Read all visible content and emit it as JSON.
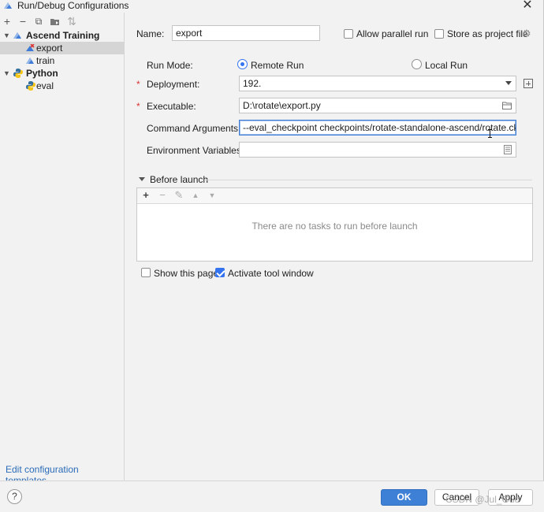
{
  "window": {
    "title": "Run/Debug Configurations",
    "close_glyph": "✕"
  },
  "toolbar": {
    "add_glyph": "+",
    "remove_glyph": "−",
    "copy_glyph": "⧉",
    "sort_glyph": "⇅"
  },
  "tree": {
    "groups": [
      {
        "label": "Ascend Training",
        "expanded": true,
        "items": [
          {
            "label": "export",
            "selected": true
          },
          {
            "label": "train",
            "selected": false
          }
        ]
      },
      {
        "label": "Python",
        "expanded": true,
        "items": [
          {
            "label": "eval",
            "selected": false
          }
        ]
      }
    ],
    "arrow_expanded": "▼"
  },
  "left_footer": {
    "edit_templates": "Edit configuration templates..."
  },
  "form": {
    "name_label": "Name:",
    "name_value": "export",
    "allow_parallel_label": "Allow parallel run",
    "allow_parallel_checked": false,
    "store_project_label": "Store as project file",
    "store_project_checked": false,
    "run_mode_label": "Run Mode:",
    "remote_run_label": "Remote Run",
    "local_run_label": "Local Run",
    "run_mode_selected": "Remote Run",
    "required_mark": "*",
    "deployment_label": "Deployment:",
    "deployment_value": "192.",
    "executable_label": "Executable:",
    "executable_value": "D:\\rotate\\export.py",
    "command_args_label": "Command Arguments:",
    "command_args_value": "--eval_checkpoint  checkpoints/rotate-standalone-ascend/rotate.ckpt --fil",
    "env_vars_label": "Environment Variables:",
    "env_vars_value": ""
  },
  "before_launch": {
    "title": "Before launch",
    "add_glyph": "+",
    "remove_glyph": "−",
    "edit_glyph": "✎",
    "up_glyph": "▲",
    "down_glyph": "▼",
    "empty_message": "There are no tasks to run before launch"
  },
  "options": {
    "show_page_label": "Show this page",
    "show_page_checked": false,
    "activate_tool_label": "Activate tool window",
    "activate_tool_checked": true
  },
  "buttons": {
    "help_glyph": "?",
    "ok": "OK",
    "cancel": "Cancel",
    "apply": "Apply"
  },
  "watermark": "CSDN @Jul_Guo",
  "colors": {
    "accent": "#3574f0",
    "ok_button": "#3d80d6",
    "link": "#2a6cb8",
    "required": "#dd3333"
  }
}
